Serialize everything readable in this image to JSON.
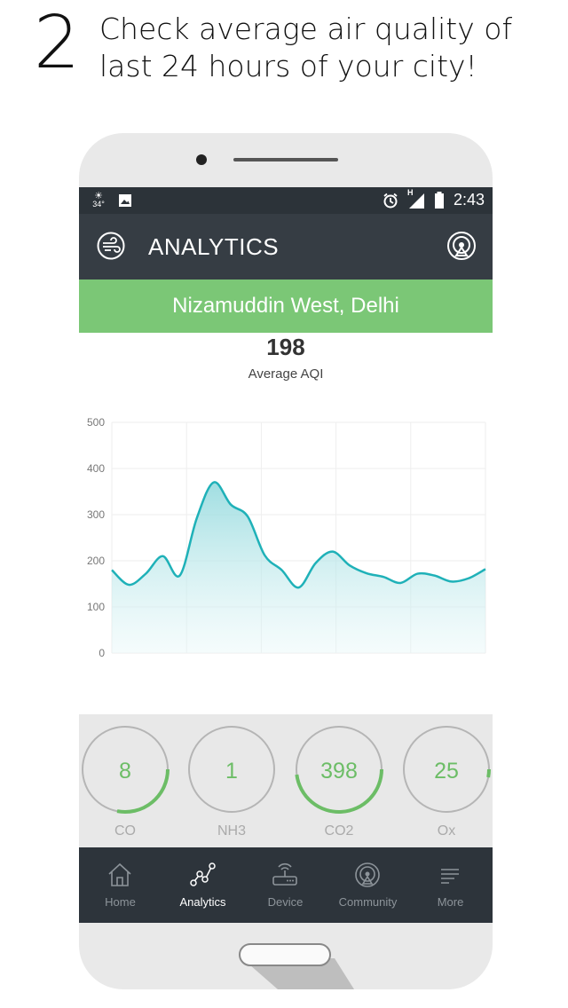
{
  "step": {
    "number": "2",
    "caption": "Check average air quality of last 24 hours of your city!"
  },
  "status_bar": {
    "weather_temp": "34°",
    "time": "2:43",
    "network": "H"
  },
  "app_bar": {
    "title": "ANALYTICS",
    "logo_icon": "wind-logo-icon",
    "action_icon": "broadcast-icon"
  },
  "location": "Nizamuddin West, Delhi",
  "average_aqi": {
    "value": "198",
    "label": "Average AQI"
  },
  "chart_data": {
    "type": "area",
    "title": "",
    "xlabel": "",
    "ylabel": "",
    "ylim": [
      0,
      500
    ],
    "y_ticks": [
      "500",
      "400",
      "300",
      "200",
      "100",
      "0"
    ],
    "grid": true,
    "series": [
      {
        "values": [
          180,
          148,
          172,
          210,
          168,
          292,
          370,
          322,
          296,
          212,
          180,
          142,
          195,
          220,
          190,
          173,
          165,
          152,
          172,
          168,
          155,
          162,
          182
        ]
      }
    ],
    "color": "#1fb1b8"
  },
  "gases": [
    {
      "value": "8",
      "label": "CO",
      "progress": 0.28
    },
    {
      "value": "1",
      "label": "NH3",
      "progress": 0.0
    },
    {
      "value": "398",
      "label": "CO2",
      "progress": 0.48
    },
    {
      "value": "25",
      "label": "Ox",
      "progress": 0.03
    }
  ],
  "nav": [
    {
      "label": "Home",
      "icon": "home-icon",
      "active": false
    },
    {
      "label": "Analytics",
      "icon": "analytics-icon",
      "active": true
    },
    {
      "label": "Device",
      "icon": "router-icon",
      "active": false
    },
    {
      "label": "Community",
      "icon": "broadcast-icon",
      "active": false
    },
    {
      "label": "More",
      "icon": "menu-lines-icon",
      "active": false
    }
  ],
  "colors": {
    "accent_green": "#7bc776",
    "chart_line": "#1fb1b8",
    "dark_bar": "#2d343b"
  }
}
